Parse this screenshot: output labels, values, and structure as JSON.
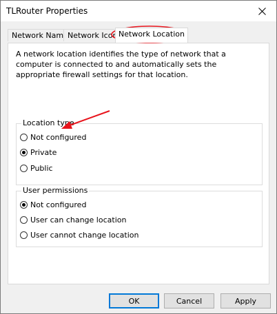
{
  "window": {
    "title": "TLRouter Properties"
  },
  "tabs": [
    {
      "label": "Network Name",
      "active": false
    },
    {
      "label": "Network Icon",
      "active": false
    },
    {
      "label": "Network Location",
      "active": true
    }
  ],
  "description": "A network location identifies the type of network that a computer is connected to and automatically sets the appropriate firewall settings for that location.",
  "location_type": {
    "label": "Location type",
    "options": [
      {
        "label": "Not configured",
        "checked": false
      },
      {
        "label": "Private",
        "checked": true
      },
      {
        "label": "Public",
        "checked": false
      }
    ]
  },
  "user_permissions": {
    "label": "User permissions",
    "options": [
      {
        "label": "Not configured",
        "checked": true
      },
      {
        "label": "User can change location",
        "checked": false
      },
      {
        "label": "User cannot change location",
        "checked": false
      }
    ]
  },
  "buttons": {
    "ok": "OK",
    "cancel": "Cancel",
    "apply": "Apply"
  },
  "annotation": {
    "color": "#e8141c",
    "circled_item": "Network Location tab",
    "arrow_target": "Private option"
  }
}
